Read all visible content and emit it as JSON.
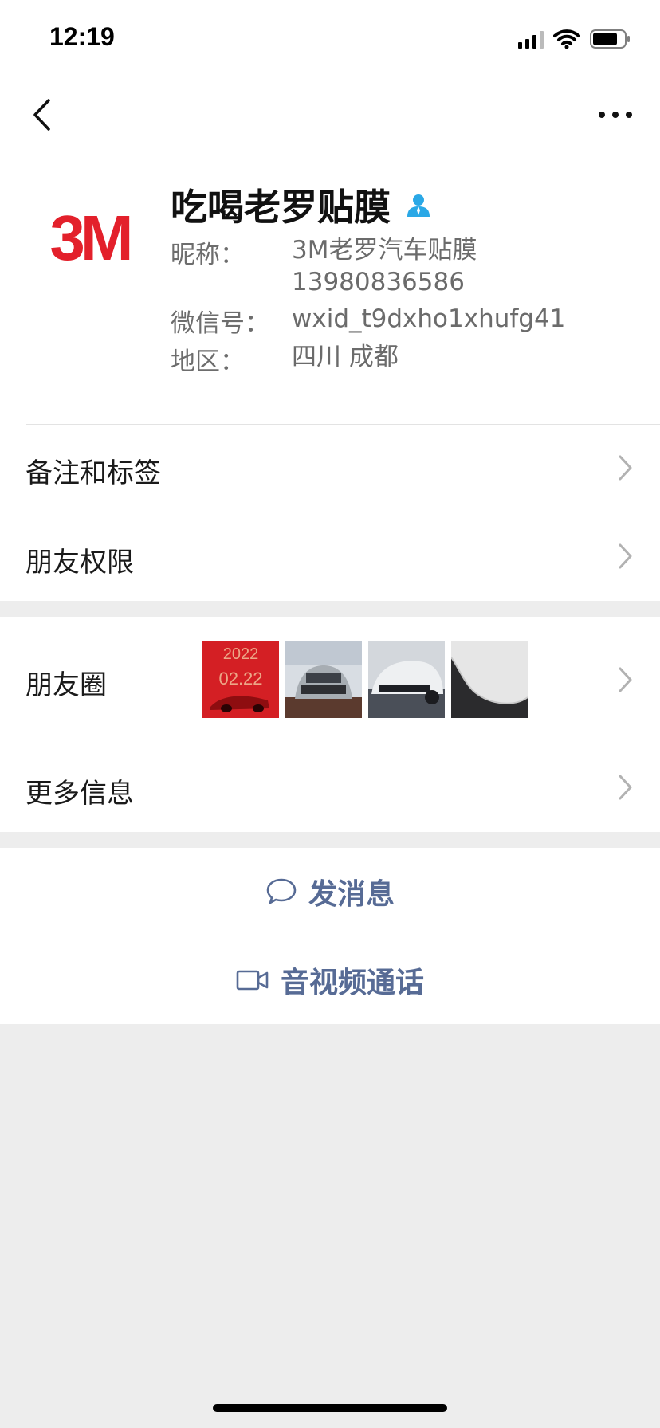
{
  "status_bar": {
    "time": "12:19"
  },
  "profile": {
    "name": "吃喝老罗贴膜",
    "avatar_text": "3M",
    "nickname_label": "昵称：",
    "nickname_line1": "3M老罗汽车贴膜",
    "nickname_line2": "13980836586",
    "wechat_id_label": "微信号：",
    "wechat_id": "wxid_t9dxho1xhufg41",
    "region_label": "地区：",
    "region": "四川 成都"
  },
  "cells": {
    "remarks": "备注和标签",
    "permissions": "朋友权限",
    "moments": "朋友圈",
    "more_info": "更多信息"
  },
  "moments_thumbs_text": {
    "thumb1_year": "2022",
    "thumb1_date": "02.22"
  },
  "actions": {
    "send_message": "发消息",
    "video_call": "音视频通话"
  },
  "colors": {
    "brand_red": "#e3202b",
    "link_blue": "#576b95",
    "verified_blue": "#2aa8e6",
    "background": "#ededed"
  },
  "icons": {
    "back": "chevron-left-icon",
    "more": "more-dots-icon",
    "verified": "person-icon",
    "chevron": "chevron-right-icon",
    "message": "chat-bubble-icon",
    "video": "video-camera-icon"
  }
}
